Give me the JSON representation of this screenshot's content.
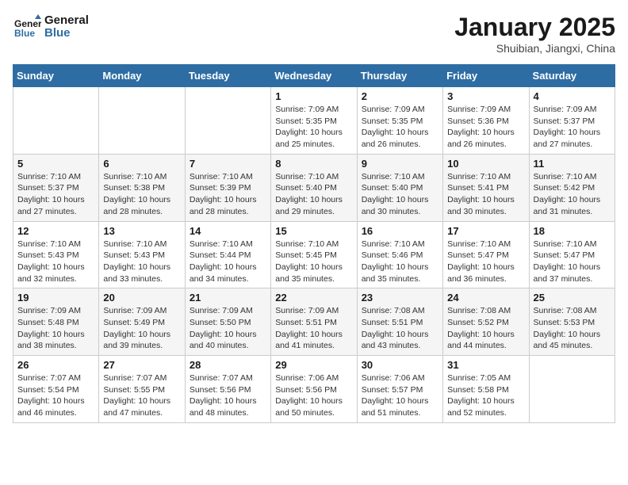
{
  "header": {
    "logo_line1": "General",
    "logo_line2": "Blue",
    "month_title": "January 2025",
    "location": "Shuibian, Jiangxi, China"
  },
  "weekdays": [
    "Sunday",
    "Monday",
    "Tuesday",
    "Wednesday",
    "Thursday",
    "Friday",
    "Saturday"
  ],
  "weeks": [
    [
      {
        "num": "",
        "info": ""
      },
      {
        "num": "",
        "info": ""
      },
      {
        "num": "",
        "info": ""
      },
      {
        "num": "1",
        "info": "Sunrise: 7:09 AM\nSunset: 5:35 PM\nDaylight: 10 hours\nand 25 minutes."
      },
      {
        "num": "2",
        "info": "Sunrise: 7:09 AM\nSunset: 5:35 PM\nDaylight: 10 hours\nand 26 minutes."
      },
      {
        "num": "3",
        "info": "Sunrise: 7:09 AM\nSunset: 5:36 PM\nDaylight: 10 hours\nand 26 minutes."
      },
      {
        "num": "4",
        "info": "Sunrise: 7:09 AM\nSunset: 5:37 PM\nDaylight: 10 hours\nand 27 minutes."
      }
    ],
    [
      {
        "num": "5",
        "info": "Sunrise: 7:10 AM\nSunset: 5:37 PM\nDaylight: 10 hours\nand 27 minutes."
      },
      {
        "num": "6",
        "info": "Sunrise: 7:10 AM\nSunset: 5:38 PM\nDaylight: 10 hours\nand 28 minutes."
      },
      {
        "num": "7",
        "info": "Sunrise: 7:10 AM\nSunset: 5:39 PM\nDaylight: 10 hours\nand 28 minutes."
      },
      {
        "num": "8",
        "info": "Sunrise: 7:10 AM\nSunset: 5:40 PM\nDaylight: 10 hours\nand 29 minutes."
      },
      {
        "num": "9",
        "info": "Sunrise: 7:10 AM\nSunset: 5:40 PM\nDaylight: 10 hours\nand 30 minutes."
      },
      {
        "num": "10",
        "info": "Sunrise: 7:10 AM\nSunset: 5:41 PM\nDaylight: 10 hours\nand 30 minutes."
      },
      {
        "num": "11",
        "info": "Sunrise: 7:10 AM\nSunset: 5:42 PM\nDaylight: 10 hours\nand 31 minutes."
      }
    ],
    [
      {
        "num": "12",
        "info": "Sunrise: 7:10 AM\nSunset: 5:43 PM\nDaylight: 10 hours\nand 32 minutes."
      },
      {
        "num": "13",
        "info": "Sunrise: 7:10 AM\nSunset: 5:43 PM\nDaylight: 10 hours\nand 33 minutes."
      },
      {
        "num": "14",
        "info": "Sunrise: 7:10 AM\nSunset: 5:44 PM\nDaylight: 10 hours\nand 34 minutes."
      },
      {
        "num": "15",
        "info": "Sunrise: 7:10 AM\nSunset: 5:45 PM\nDaylight: 10 hours\nand 35 minutes."
      },
      {
        "num": "16",
        "info": "Sunrise: 7:10 AM\nSunset: 5:46 PM\nDaylight: 10 hours\nand 35 minutes."
      },
      {
        "num": "17",
        "info": "Sunrise: 7:10 AM\nSunset: 5:47 PM\nDaylight: 10 hours\nand 36 minutes."
      },
      {
        "num": "18",
        "info": "Sunrise: 7:10 AM\nSunset: 5:47 PM\nDaylight: 10 hours\nand 37 minutes."
      }
    ],
    [
      {
        "num": "19",
        "info": "Sunrise: 7:09 AM\nSunset: 5:48 PM\nDaylight: 10 hours\nand 38 minutes."
      },
      {
        "num": "20",
        "info": "Sunrise: 7:09 AM\nSunset: 5:49 PM\nDaylight: 10 hours\nand 39 minutes."
      },
      {
        "num": "21",
        "info": "Sunrise: 7:09 AM\nSunset: 5:50 PM\nDaylight: 10 hours\nand 40 minutes."
      },
      {
        "num": "22",
        "info": "Sunrise: 7:09 AM\nSunset: 5:51 PM\nDaylight: 10 hours\nand 41 minutes."
      },
      {
        "num": "23",
        "info": "Sunrise: 7:08 AM\nSunset: 5:51 PM\nDaylight: 10 hours\nand 43 minutes."
      },
      {
        "num": "24",
        "info": "Sunrise: 7:08 AM\nSunset: 5:52 PM\nDaylight: 10 hours\nand 44 minutes."
      },
      {
        "num": "25",
        "info": "Sunrise: 7:08 AM\nSunset: 5:53 PM\nDaylight: 10 hours\nand 45 minutes."
      }
    ],
    [
      {
        "num": "26",
        "info": "Sunrise: 7:07 AM\nSunset: 5:54 PM\nDaylight: 10 hours\nand 46 minutes."
      },
      {
        "num": "27",
        "info": "Sunrise: 7:07 AM\nSunset: 5:55 PM\nDaylight: 10 hours\nand 47 minutes."
      },
      {
        "num": "28",
        "info": "Sunrise: 7:07 AM\nSunset: 5:56 PM\nDaylight: 10 hours\nand 48 minutes."
      },
      {
        "num": "29",
        "info": "Sunrise: 7:06 AM\nSunset: 5:56 PM\nDaylight: 10 hours\nand 50 minutes."
      },
      {
        "num": "30",
        "info": "Sunrise: 7:06 AM\nSunset: 5:57 PM\nDaylight: 10 hours\nand 51 minutes."
      },
      {
        "num": "31",
        "info": "Sunrise: 7:05 AM\nSunset: 5:58 PM\nDaylight: 10 hours\nand 52 minutes."
      },
      {
        "num": "",
        "info": ""
      }
    ]
  ]
}
